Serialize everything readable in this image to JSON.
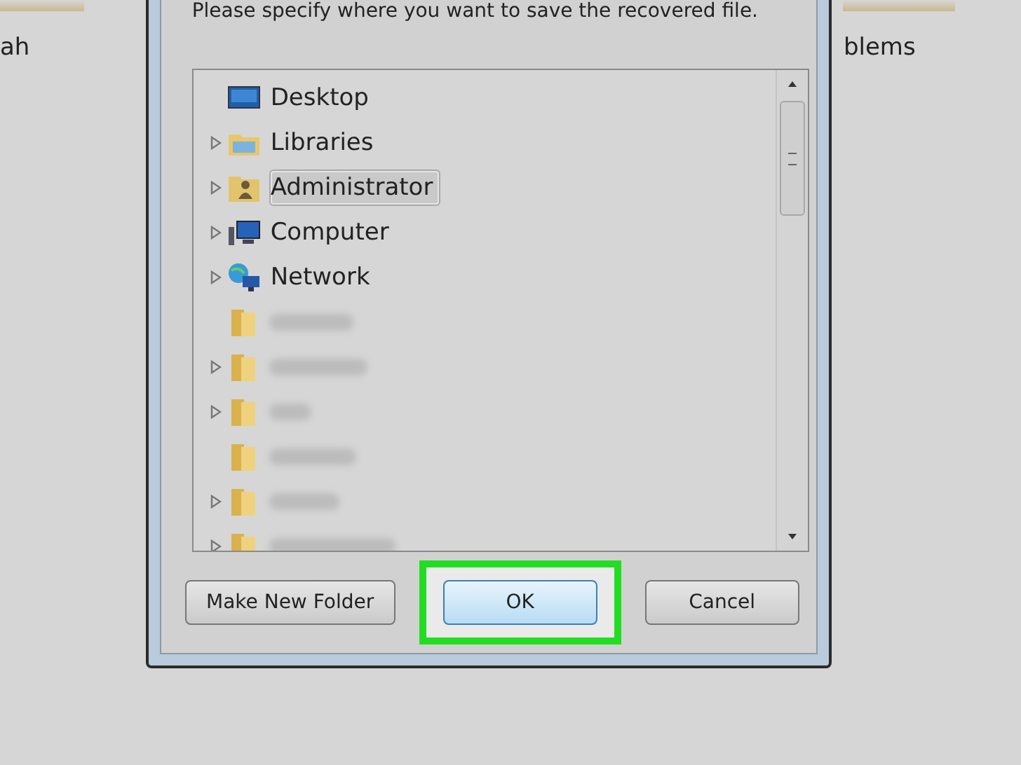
{
  "background": {
    "left_text": "ah",
    "right_text": "blems"
  },
  "dialog": {
    "prompt": "Please specify where you want to save the recovered file.",
    "tree": [
      {
        "kind": "desktop",
        "label": "Desktop",
        "expandable": false,
        "selected": false
      },
      {
        "kind": "libraries",
        "label": "Libraries",
        "expandable": true,
        "selected": false
      },
      {
        "kind": "user",
        "label": "Administrator",
        "expandable": true,
        "selected": true
      },
      {
        "kind": "computer",
        "label": "Computer",
        "expandable": true,
        "selected": false
      },
      {
        "kind": "network",
        "label": "Network",
        "expandable": true,
        "selected": false
      },
      {
        "kind": "folder",
        "blurred": true,
        "expandable": false
      },
      {
        "kind": "folder",
        "blurred": true,
        "expandable": true
      },
      {
        "kind": "folder",
        "blurred": true,
        "expandable": true
      },
      {
        "kind": "folder",
        "blurred": true,
        "expandable": false
      },
      {
        "kind": "folder",
        "blurred": true,
        "expandable": true
      },
      {
        "kind": "folder",
        "blurred": true,
        "expandable": true
      }
    ],
    "buttons": [
      {
        "label": "Make New Folder",
        "highlighted": false,
        "default": false
      },
      {
        "label": "OK",
        "highlighted": true,
        "default": true
      },
      {
        "label": "Cancel",
        "highlighted": false,
        "default": false
      }
    ]
  }
}
